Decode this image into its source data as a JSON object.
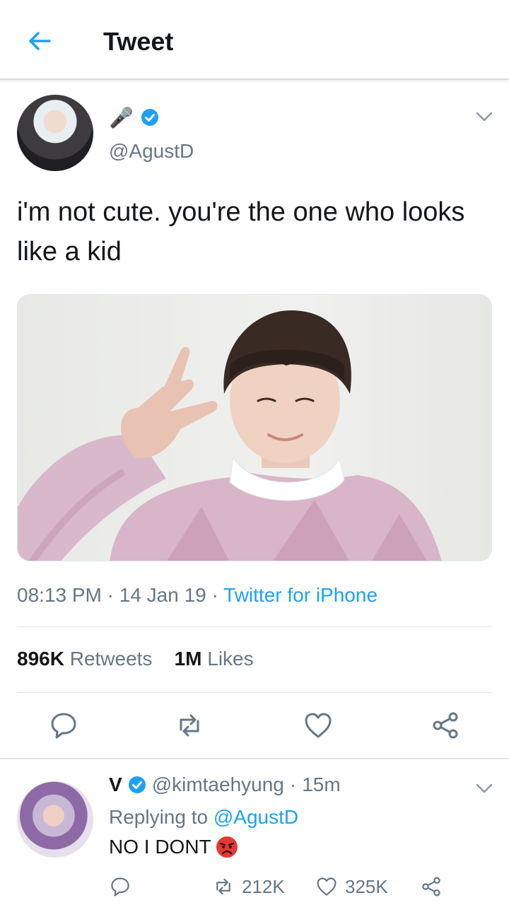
{
  "header": {
    "title": "Tweet",
    "back_icon": "arrow-left-icon"
  },
  "tweet": {
    "emoji_name": "🎤",
    "handle": "@AgustD",
    "text": "i'm not cute. you're the one who looks like a kid",
    "time": "08:13 PM",
    "date": "14 Jan 19",
    "source": "Twitter for iPhone",
    "retweets_count": "896K",
    "retweets_label": "Retweets",
    "likes_count": "1M",
    "likes_label": "Likes"
  },
  "reply": {
    "name": "V",
    "handle": "@kimtaehyung",
    "age": "15m",
    "replying_prefix": "Replying to",
    "replying_to": "@AgustD",
    "text": "NO I DONT",
    "retweets": "212K",
    "likes": "325K"
  },
  "colors": {
    "accent": "#1da1f2",
    "muted": "#657786",
    "text": "#14171a",
    "divider": "#e1e8ed"
  }
}
